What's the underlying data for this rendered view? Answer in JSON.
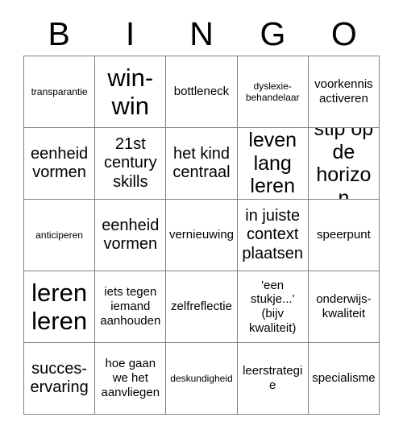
{
  "card": {
    "title": "BINGO",
    "columns": [
      {
        "letter": "B"
      },
      {
        "letter": "I"
      },
      {
        "letter": "N"
      },
      {
        "letter": "G"
      },
      {
        "letter": "O"
      }
    ],
    "grid_size": "5x5",
    "border_color": "#808080",
    "text_color": "#000000",
    "background_color": "#ffffff",
    "cells": [
      {
        "text": "transparantie",
        "size": "sz-xs",
        "column": "B",
        "row": 1
      },
      {
        "text": "win-win",
        "size": "sz-xl",
        "column": "I",
        "row": 1
      },
      {
        "text": "bottleneck",
        "size": "sz-sm",
        "column": "N",
        "row": 1
      },
      {
        "text": "dyslexie-behandelaar",
        "size": "sz-xs",
        "column": "G",
        "row": 1
      },
      {
        "text": "voorkennis activeren",
        "size": "sz-sm",
        "column": "O",
        "row": 1
      },
      {
        "text": "eenheid vormen",
        "size": "sz-md",
        "column": "B",
        "row": 2
      },
      {
        "text": "21st century skills",
        "size": "sz-md",
        "column": "I",
        "row": 2
      },
      {
        "text": "het kind centraal",
        "size": "sz-md",
        "column": "N",
        "row": 2
      },
      {
        "text": "leven lang leren",
        "size": "sz-lg",
        "column": "G",
        "row": 2
      },
      {
        "text": "stip op de horizon",
        "size": "sz-lg",
        "column": "O",
        "row": 2
      },
      {
        "text": "anticiperen",
        "size": "sz-xs",
        "column": "B",
        "row": 3
      },
      {
        "text": "eenheid vormen",
        "size": "sz-md",
        "column": "I",
        "row": 3
      },
      {
        "text": "vernieuwing",
        "size": "sz-sm",
        "column": "N",
        "row": 3
      },
      {
        "text": "in juiste context plaatsen",
        "size": "sz-md",
        "column": "G",
        "row": 3
      },
      {
        "text": "speerpunt",
        "size": "sz-sm",
        "column": "O",
        "row": 3
      },
      {
        "text": "leren leren",
        "size": "sz-xl",
        "column": "B",
        "row": 4
      },
      {
        "text": "iets tegen iemand aanhouden",
        "size": "sz-sm",
        "column": "I",
        "row": 4
      },
      {
        "text": "zelfreflectie",
        "size": "sz-sm",
        "column": "N",
        "row": 4
      },
      {
        "text": "'een stukje...' (bijv kwaliteit)",
        "size": "sz-sm",
        "column": "G",
        "row": 4
      },
      {
        "text": "onderwijs-kwaliteit",
        "size": "sz-sm",
        "column": "O",
        "row": 4
      },
      {
        "text": "succes-ervaring",
        "size": "sz-md",
        "column": "B",
        "row": 5
      },
      {
        "text": "hoe gaan we het aanvliegen",
        "size": "sz-sm",
        "column": "I",
        "row": 5
      },
      {
        "text": "deskundigheid",
        "size": "sz-xs",
        "column": "N",
        "row": 5
      },
      {
        "text": "leerstrategie",
        "size": "sz-sm",
        "column": "G",
        "row": 5
      },
      {
        "text": "specialisme",
        "size": "sz-sm",
        "column": "O",
        "row": 5
      }
    ]
  }
}
